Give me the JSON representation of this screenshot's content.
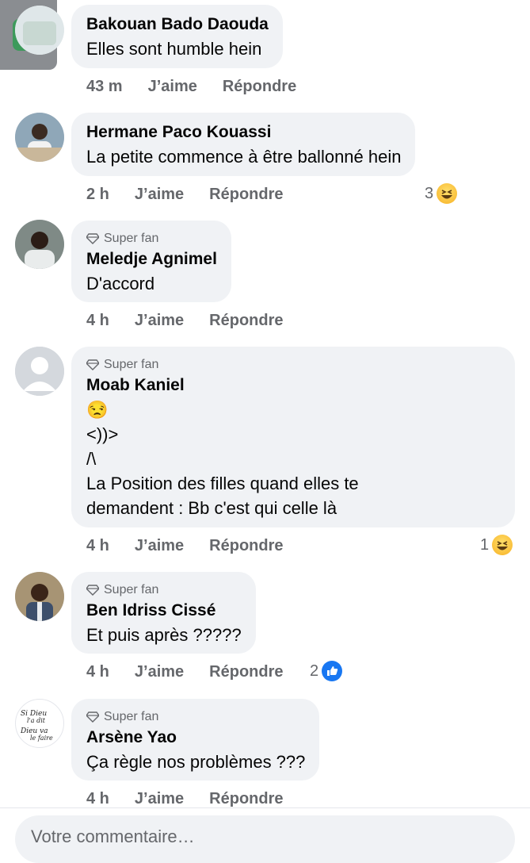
{
  "comments": [
    {
      "author": "Bakouan Bado Daouda",
      "badge": "",
      "text": "Elles sont humble hein",
      "time": "43 m",
      "like": "J’aime",
      "reply": "Répondre",
      "reaction_count": "",
      "reaction": ""
    },
    {
      "author": "Hermane Paco Kouassi",
      "badge": "",
      "text": "La petite commence à être ballonné hein",
      "time": "2 h",
      "like": "J’aime",
      "reply": "Répondre",
      "reaction_count": "3",
      "reaction": "haha-emoji"
    },
    {
      "author": "Meledje Agnimel",
      "badge": "Super fan",
      "text": "D'accord",
      "time": "4 h",
      "like": "J’aime",
      "reply": "Répondre",
      "reaction_count": "",
      "reaction": ""
    },
    {
      "author": "Moab Kaniel",
      "badge": "Super fan",
      "text": "😒\n<))>\n/\\\nLa Position des filles quand elles te\ndemandent : Bb c'est qui celle là",
      "time": "4 h",
      "like": "J’aime",
      "reply": "Répondre",
      "reaction_count": "1",
      "reaction": "haha-emoji"
    },
    {
      "author": "Ben Idriss Cissé",
      "badge": "Super fan",
      "text": "Et puis après ?????",
      "time": "4 h",
      "like": "J’aime",
      "reply": "Répondre",
      "reaction_count": "2",
      "reaction": "like-emoji"
    },
    {
      "author": "Arsène Yao",
      "badge": "Super fan",
      "text": "Ça règle nos problèmes ???",
      "time": "4 h",
      "like": "J’aime",
      "reply": "Répondre",
      "reaction_count": "",
      "reaction": ""
    }
  ],
  "avatar6_text": "Si Dieu l'a dit Dieu va le faire",
  "composer": {
    "placeholder": "Votre commentaire…"
  },
  "colors": {
    "bubble": "#f0f2f5",
    "meta": "#65676b",
    "like_blue": "#1877f2"
  }
}
